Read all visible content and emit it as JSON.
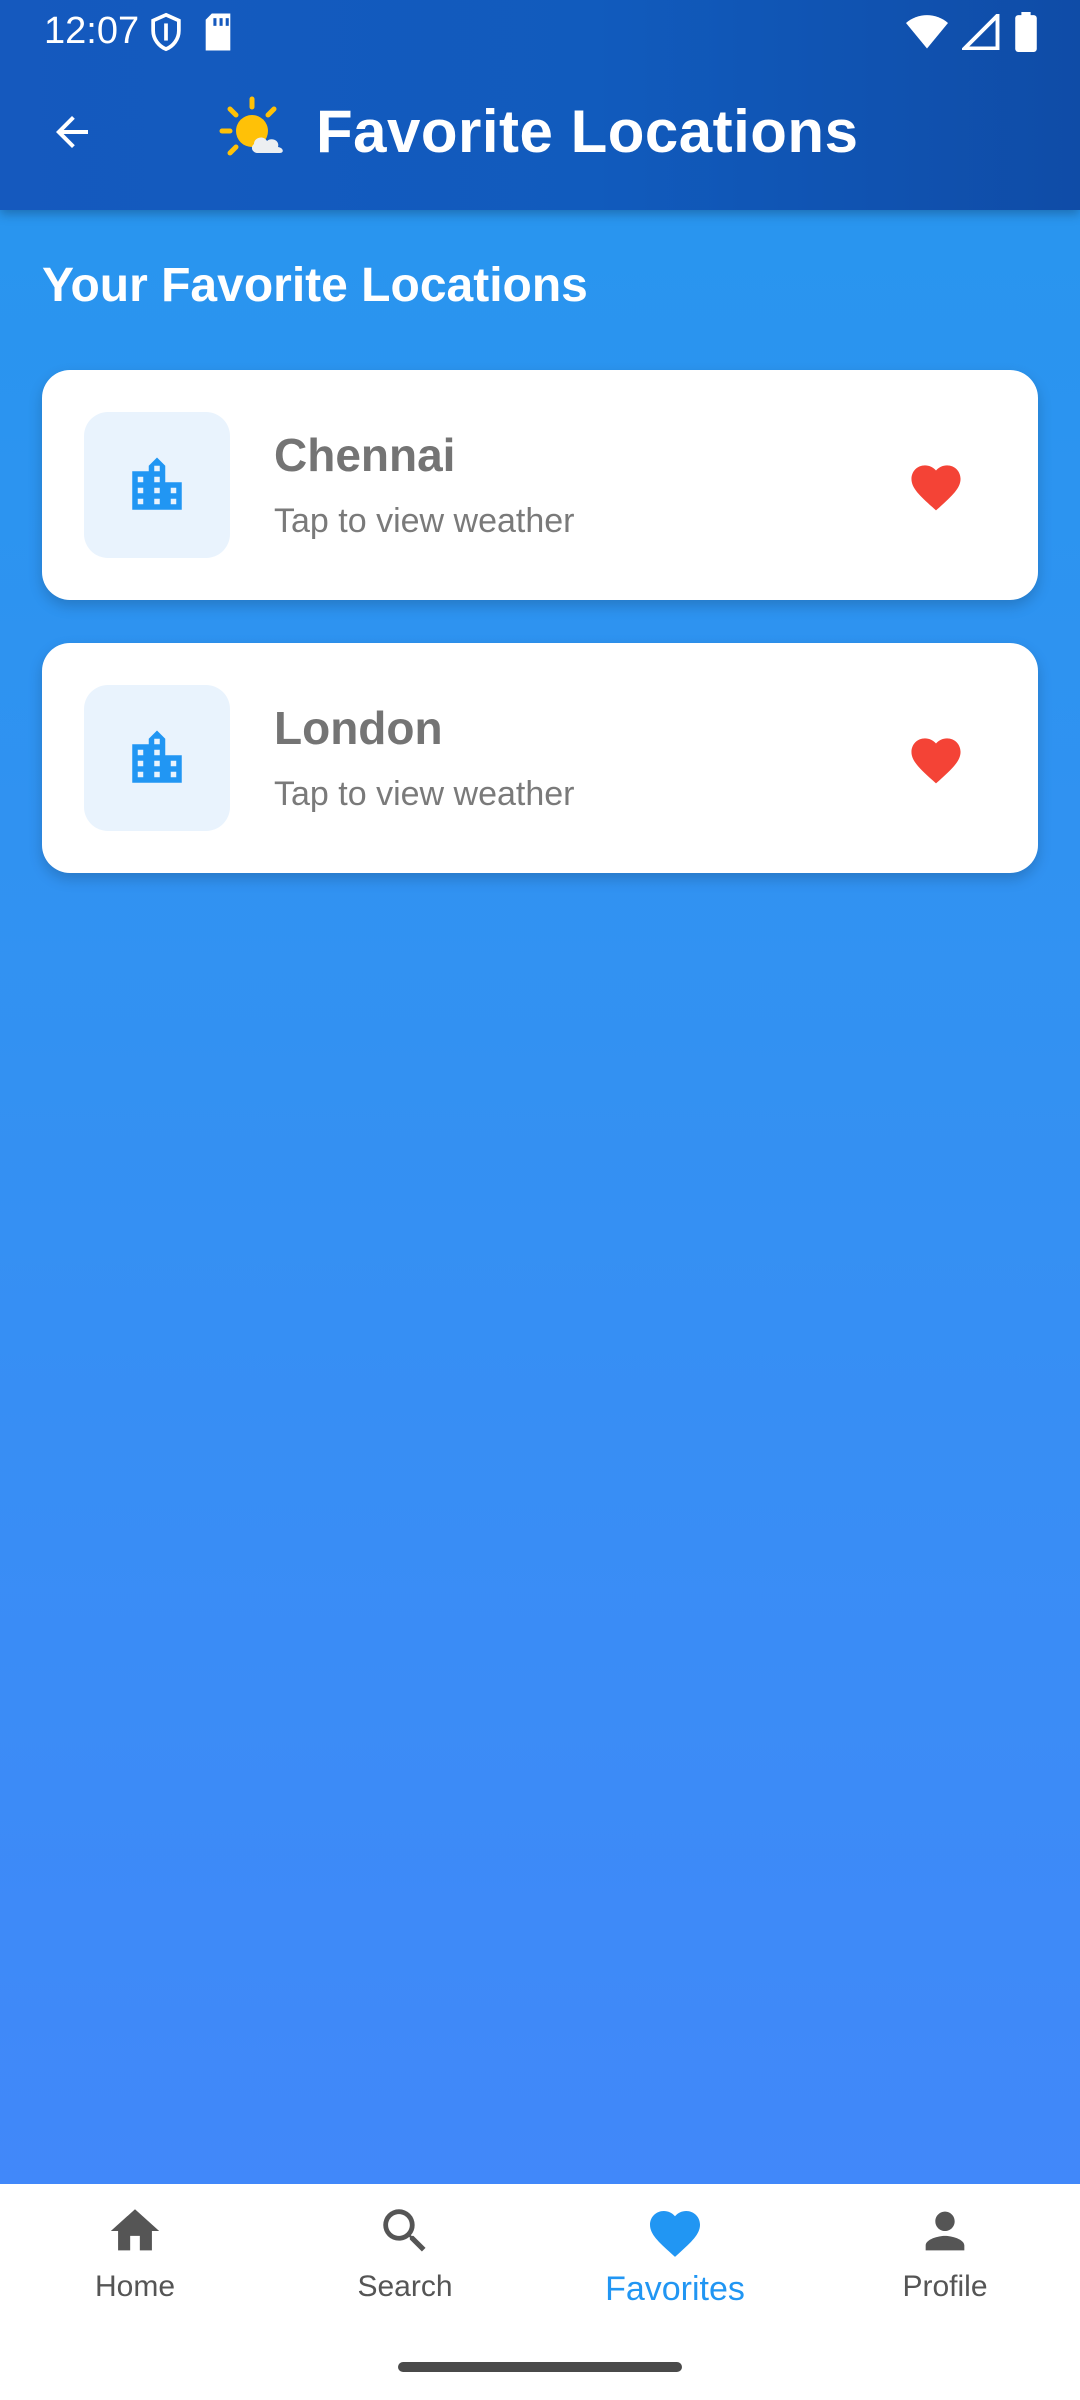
{
  "status_bar": {
    "time": "12:07",
    "left_icons": [
      "shield-icon",
      "sd-card-icon"
    ],
    "right_icons": [
      "wifi-icon",
      "signal-icon",
      "battery-icon"
    ]
  },
  "app_bar": {
    "title": "Favorite Locations",
    "back_icon": "arrow-back-icon",
    "logo_icon": "sun-cloud-icon"
  },
  "section": {
    "title": "Your Favorite Locations"
  },
  "favorites": [
    {
      "city": "Chennai",
      "subtitle": "Tap to view weather",
      "icon": "city-icon",
      "action_icon": "heart-icon"
    },
    {
      "city": "London",
      "subtitle": "Tap to view weather",
      "icon": "city-icon",
      "action_icon": "heart-icon"
    }
  ],
  "bottom_nav": {
    "items": [
      {
        "label": "Home",
        "icon": "home-icon"
      },
      {
        "label": "Search",
        "icon": "search-icon"
      },
      {
        "label": "Favorites",
        "icon": "heart-icon",
        "active": true
      },
      {
        "label": "Profile",
        "icon": "person-icon"
      }
    ]
  },
  "colors": {
    "app_bar": "#1559BE",
    "background_top": "#2696EE",
    "background_bottom": "#4486FB",
    "accent": "#2196F3",
    "heart": "#F44336"
  }
}
